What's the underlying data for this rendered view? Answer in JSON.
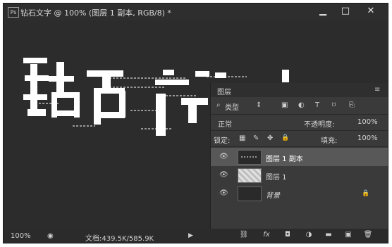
{
  "window": {
    "app_badge": "Ps",
    "document_title": "钻石文字 @ 100% (图层 1 副本, RGB/8) *",
    "min_label": "▁",
    "max_label": "□",
    "close_label": "✕"
  },
  "canvas": {
    "artwork_text": "钻石文字",
    "text_color": "#ffffff",
    "background_color": "#2c2c2c"
  },
  "layers_panel": {
    "title": "图层",
    "menu_icon": "≡",
    "filter": {
      "search_icon": "⌕",
      "kind_label": "类型",
      "arrows": "⇕"
    },
    "filter_icons": [
      "image-filter-icon",
      "adjustment-filter-icon",
      "text-filter-icon",
      "shape-filter-icon",
      "smart-object-filter-icon"
    ],
    "filter_glyphs": [
      "▣",
      "◐",
      "T",
      "⌑",
      "⎘"
    ],
    "blend_mode": "正常",
    "opacity_label": "不透明度:",
    "opacity_value": "100%",
    "lock_label": "锁定:",
    "lock_glyphs": [
      "▦",
      "✎",
      "✥",
      "🔒"
    ],
    "fill_label": "填充:",
    "fill_value": "100%",
    "layers": [
      {
        "name": "图层 1 副本",
        "visible": true,
        "selected": true
      },
      {
        "name": "图层 1",
        "visible": true,
        "selected": false
      },
      {
        "name": "背景",
        "visible": true,
        "selected": false,
        "locked": true
      }
    ],
    "footer_glyphs": [
      "⛓",
      "fx",
      "◘",
      "◑",
      "▬",
      "▣",
      "🗑"
    ]
  },
  "status": {
    "zoom": "100%",
    "doc_info": "文档:439.5K/585.9K",
    "arrow": "▶"
  }
}
